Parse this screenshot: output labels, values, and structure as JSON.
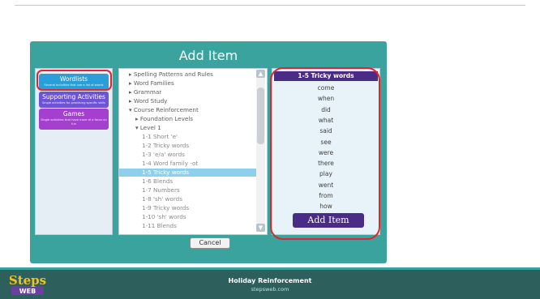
{
  "dialog": {
    "title": "Add Item",
    "cancel_label": "Cancel"
  },
  "categories": [
    {
      "label": "Wordlists",
      "sub": "Several activities that use a list of words"
    },
    {
      "label": "Supporting Activities",
      "sub": "Single activities for practising specific skills"
    },
    {
      "label": "Games",
      "sub": "Single activities that have more of a focus on fun"
    }
  ],
  "tree": [
    {
      "label": "▸ Spelling Patterns and Rules"
    },
    {
      "label": "▸ Word Families"
    },
    {
      "label": "▸ Grammar"
    },
    {
      "label": "▸ Word Study"
    },
    {
      "label": "▾ Course Reinforcement"
    },
    {
      "label": "▸ Foundation Levels"
    },
    {
      "label": "▾ Level 1"
    },
    {
      "label": "1-1 Short 'e'"
    },
    {
      "label": "1-2 Tricky words"
    },
    {
      "label": "1-3 'e/a' words"
    },
    {
      "label": "1-4 Word family -ot"
    },
    {
      "label": "1-5 Tricky words"
    },
    {
      "label": "1-6 Blends"
    },
    {
      "label": "1-7 Numbers"
    },
    {
      "label": "1-8 'sh' words"
    },
    {
      "label": "1-9 Tricky words"
    },
    {
      "label": "1-10 'sh' words"
    },
    {
      "label": "1-11 Blends"
    }
  ],
  "wordlist": {
    "title": "1-5 Tricky words",
    "words": [
      "come",
      "when",
      "did",
      "what",
      "said",
      "see",
      "were",
      "there",
      "play",
      "went",
      "from",
      "how"
    ],
    "add_label": "Add Item"
  },
  "footer": {
    "title": "Holiday Reinforcement",
    "url": "stepsweb.com",
    "logo_top": "Steps",
    "logo_bottom": "WEB"
  },
  "colors": {
    "dialog": "#3aa39d",
    "header": "#4a2c86",
    "selected": "#8ed0ec",
    "highlight": "#e3242b",
    "footer": "#2d5f5d"
  }
}
